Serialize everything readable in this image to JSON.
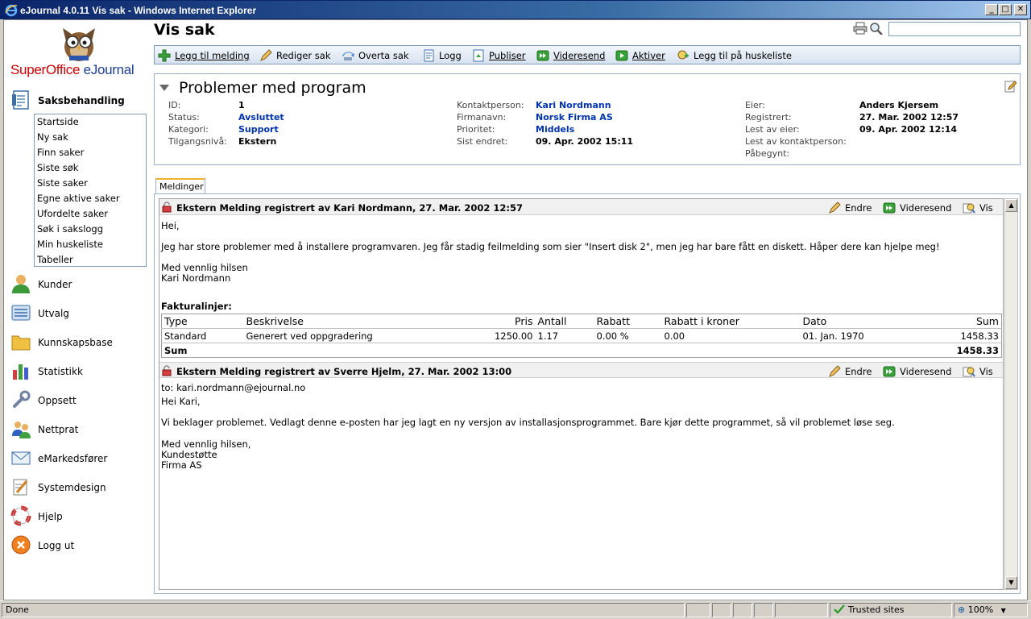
{
  "window": {
    "title": "eJournal 4.0.11 Vis sak - Windows Internet Explorer"
  },
  "logo": {
    "part1": "SuperOffice ",
    "part2": "eJournal"
  },
  "sidebar": {
    "section_active": "Saksbehandling",
    "subitems": [
      "Startside",
      "Ny sak",
      "Finn saker",
      "Siste søk",
      "Siste saker",
      "Egne aktive saker",
      "Ufordelte saker",
      "Søk i sakslogg",
      "Min huskeliste",
      "Tabeller"
    ],
    "sections": [
      "Kunder",
      "Utvalg",
      "Kunnskapsbase",
      "Statistikk",
      "Oppsett",
      "Nettprat",
      "eMarkedsfører",
      "Systemdesign",
      "Hjelp",
      "Logg ut"
    ]
  },
  "page": {
    "title": "Vis sak"
  },
  "toolbar": {
    "add_message": "Legg til melding",
    "edit_case": "Rediger sak",
    "take_over": "Overta sak",
    "log": "Logg",
    "publish": "Publiser",
    "forward": "Videresend",
    "activate": "Aktiver",
    "add_reminder": "Legg til på huskeliste"
  },
  "case": {
    "subject": "Problemer med program",
    "col1": [
      {
        "label": "ID:",
        "value": "1"
      },
      {
        "label": "Status:",
        "value": "Avsluttet"
      },
      {
        "label": "Kategori:",
        "value": "Support"
      },
      {
        "label": "Tilgangsnivå:",
        "value": "Ekstern"
      }
    ],
    "col2": [
      {
        "label": "Kontaktperson:",
        "value": "Kari Nordmann"
      },
      {
        "label": "Firmanavn:",
        "value": "Norsk Firma AS"
      },
      {
        "label": "Prioritet:",
        "value": "Middels"
      },
      {
        "label": "Sist endret:",
        "value": "09. Apr. 2002 15:11"
      }
    ],
    "col3": [
      {
        "label": "Eier:",
        "value": "Anders Kjersem"
      },
      {
        "label": "Registrert:",
        "value": "27. Mar. 2002 12:57"
      },
      {
        "label": "Lest av eier:",
        "value": "09. Apr. 2002 12:14"
      },
      {
        "label": "Lest av kontaktperson:",
        "value": ""
      },
      {
        "label": "Påbegynt:",
        "value": ""
      }
    ]
  },
  "tabs": {
    "messages": "Meldinger"
  },
  "actions": {
    "edit": "Endre",
    "forward": "Videresend",
    "view": "Vis"
  },
  "messages": [
    {
      "header": "Ekstern Melding registrert av Kari Nordmann, 27. Mar. 2002 12:57",
      "lines": [
        "Hei,",
        "",
        "Jeg har store problemer med å installere programvaren. Jeg får stadig feilmelding som sier \"Insert disk 2\", men jeg har bare fått en diskett. Håper dere kan hjelpe meg!",
        "",
        "Med vennlig hilsen",
        "Kari Nordmann"
      ]
    },
    {
      "header": "Ekstern Melding registrert av Sverre Hjelm, 27. Mar. 2002 13:00",
      "lines": [
        "to: kari.nordmann@ejournal.no",
        "Hei Kari,",
        "",
        "Vi beklager problemet. Vedlagt denne e-posten har jeg lagt en ny versjon av installasjonsprogrammet. Bare kjør dette programmet, så vil problemet løse seg.",
        "",
        "Med vennlig hilsen,",
        "Kundestøtte",
        "Firma AS"
      ]
    }
  ],
  "invoice": {
    "title": "Fakturalinjer:",
    "headers": [
      "Type",
      "Beskrivelse",
      "Pris",
      "Antall",
      "Rabatt",
      "Rabatt i kroner",
      "Dato",
      "Sum"
    ],
    "row": [
      "Standard",
      "Generert ved oppgradering",
      "1250.00",
      "1.17",
      "0.00 %",
      "0.00",
      "01. Jan. 1970",
      "1458.33"
    ],
    "sum_label": "Sum",
    "sum_value": "1458.33"
  },
  "statusbar": {
    "status": "Done",
    "zone": "Trusted sites",
    "zoom": "100%"
  },
  "colors": {
    "link": "#0033aa",
    "accent_tab": "#f0b030",
    "logo_red": "#cc0000",
    "logo_blue": "#1f3f8f"
  }
}
